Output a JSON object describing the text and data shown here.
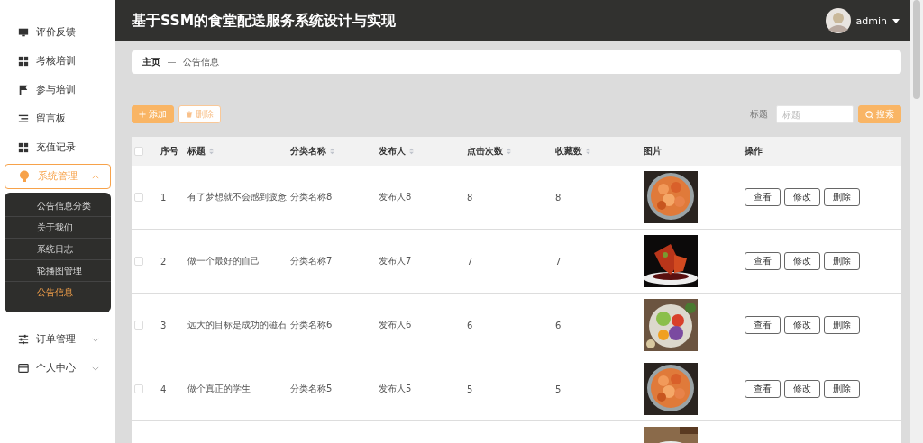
{
  "header": {
    "title": "基于SSM的食堂配送服务系统设计与实现",
    "user": "admin"
  },
  "sidebar": {
    "items": [
      {
        "label": "评价反馈",
        "selected": false
      },
      {
        "label": "考核培训",
        "selected": false
      },
      {
        "label": "参与培训",
        "selected": false
      },
      {
        "label": "留言板",
        "selected": false
      },
      {
        "label": "充值记录",
        "selected": false
      },
      {
        "label": "系统管理",
        "expanded": true,
        "selected": true,
        "children": [
          {
            "label": "公告信息分类",
            "selected": false
          },
          {
            "label": "关于我们",
            "selected": false
          },
          {
            "label": "系统日志",
            "selected": false
          },
          {
            "label": "轮播图管理",
            "selected": false
          },
          {
            "label": "公告信息",
            "selected": true
          }
        ]
      },
      {
        "label": "订单管理",
        "expanded": false,
        "selected": false
      },
      {
        "label": "个人中心",
        "expanded": false,
        "selected": false
      }
    ]
  },
  "breadcrumb": [
    "主页",
    "公告信息"
  ],
  "toolbar": {
    "add": "添加",
    "delete": "删除",
    "search_label": "标题",
    "search_placeholder": "标题",
    "search_button": "搜索"
  },
  "table": {
    "select_all_checked": false,
    "columns": [
      {
        "label": "序号",
        "sortable": false
      },
      {
        "label": "标题",
        "sortable": true
      },
      {
        "label": "分类名称",
        "sortable": true
      },
      {
        "label": "发布人",
        "sortable": true
      },
      {
        "label": "点击次数",
        "sortable": true
      },
      {
        "label": "收藏数",
        "sortable": true
      },
      {
        "label": "图片",
        "sortable": false
      },
      {
        "label": "操作",
        "sortable": false
      }
    ],
    "rows": [
      {
        "checked": false,
        "cells": [
          "1",
          "有了梦想就不会感到疲惫",
          "分类名称8",
          "发布人8",
          "8",
          "8"
        ],
        "image": {
          "kind": "picture"
        },
        "actions": [
          "查看",
          "修改",
          "删除"
        ]
      },
      {
        "checked": false,
        "cells": [
          "2",
          "做一个最好的自己",
          "分类名称7",
          "发布人7",
          "7",
          "7"
        ],
        "image": {
          "kind": "picture"
        },
        "actions": [
          "查看",
          "修改",
          "删除"
        ]
      },
      {
        "checked": false,
        "cells": [
          "3",
          "远大的目标是成功的磁石",
          "分类名称6",
          "发布人6",
          "6",
          "6"
        ],
        "image": {
          "kind": "picture"
        },
        "actions": [
          "查看",
          "修改",
          "删除"
        ]
      },
      {
        "checked": false,
        "cells": [
          "4",
          "做个真正的学生",
          "分类名称5",
          "发布人5",
          "5",
          "5"
        ],
        "image": {
          "kind": "picture"
        },
        "actions": [
          "查看",
          "修改",
          "删除"
        ]
      }
    ]
  }
}
